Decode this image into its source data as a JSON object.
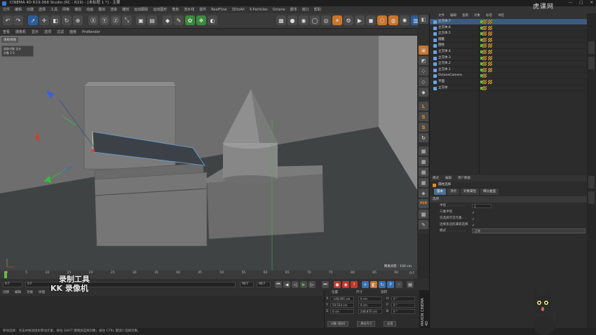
{
  "window": {
    "title": "CINEMA 4D R19.068 Studio (RC - R19) - [未标题 1 *] - 主要",
    "controls": [
      "—",
      "□",
      "✕"
    ]
  },
  "menubar": [
    "文件",
    "编辑",
    "创建",
    "选择",
    "工具",
    "网格",
    "捕捉",
    "动画",
    "模拟",
    "渲染",
    "雕刻",
    "运动跟踪",
    "运动图形",
    "角色",
    "流水线",
    "插件",
    "RealFlow",
    "3DtoAll",
    "X-Particles",
    "Octane",
    "脚本",
    "窗口",
    "帮助"
  ],
  "viewport": {
    "menu": [
      "查看",
      "摄像机",
      "显示",
      "选项",
      "过滤",
      "面板",
      "ProRender"
    ],
    "corner_label": "透视视图",
    "hud": {
      "line1": "选取对象  全计",
      "line2": "对象  1      0"
    },
    "grid_spacing": "网格间距 : 100 cm",
    "colors": {
      "bg_top": "#6f6f6f",
      "bg_floor": "#3f4344",
      "wall_right": "#8a8a8a"
    }
  },
  "objects": {
    "menu": [
      "文件",
      "编辑",
      "查看",
      "对象",
      "标签",
      "书签"
    ],
    "items": [
      {
        "name": "立方体.7",
        "selected": true
      },
      {
        "name": "立方体.6",
        "selected": false
      },
      {
        "name": "立方体.5",
        "selected": false
      },
      {
        "name": "圆锥",
        "selected": false
      },
      {
        "name": "圆柱",
        "selected": false
      },
      {
        "name": "立方体.4",
        "selected": false
      },
      {
        "name": "立方体.3",
        "selected": false
      },
      {
        "name": "立方体.2",
        "selected": false
      },
      {
        "name": "立方体.1",
        "selected": false
      },
      {
        "name": "OctaneCamera",
        "selected": false
      },
      {
        "name": "平面",
        "selected": false
      },
      {
        "name": "立方体",
        "selected": false
      }
    ]
  },
  "attributes": {
    "menu": [
      "模式",
      "编辑",
      "用户数据"
    ],
    "title": "圆柱选择",
    "tabs": [
      {
        "label": "基本",
        "active": true
      },
      {
        "label": "顶点",
        "active": false
      },
      {
        "label": "对象属性",
        "active": false
      },
      {
        "label": "细分曲面",
        "active": false
      }
    ],
    "section": "选项",
    "rows": [
      {
        "label": "半径 . . . . . . . . .",
        "value": "1"
      },
      {
        "label": "三维半径",
        "check": "✓"
      },
      {
        "label": "仅选择可见元素 . .",
        "check": "✓"
      },
      {
        "label": "边缘多边形兼容选择",
        "check": "✓"
      },
      {
        "label": "模式 . . . . . . . . . .",
        "dropdown": "正常"
      }
    ]
  },
  "timeline": {
    "ticks": [
      "0",
      "5",
      "10",
      "15",
      "20",
      "25",
      "30",
      "35",
      "40",
      "45",
      "50",
      "55",
      "60",
      "65",
      "70",
      "75",
      "80",
      "85",
      "90"
    ],
    "end_label": "0 F"
  },
  "transport": {
    "start": "0 F",
    "current": "0 F",
    "end": "90 F",
    "end2": "90 F"
  },
  "materials": {
    "menu": [
      "创建",
      "编辑",
      "功能",
      "纹理"
    ]
  },
  "coordinates": {
    "headers": [
      "位置",
      "尺寸",
      "旋转"
    ],
    "rows": [
      {
        "axis": "X",
        "pos": "-148.091 cm",
        "size": "0 cm",
        "rot_label": "H",
        "rot": "0 °"
      },
      {
        "axis": "Y",
        "pos": "50.524 cm",
        "size": "0 cm",
        "rot_label": "P",
        "rot": "0 °"
      },
      {
        "axis": "Z",
        "pos": "0 cm",
        "size": "248.870 cm",
        "rot_label": "B",
        "rot": "0 °"
      }
    ],
    "mode": "对象 (相对)",
    "size_mode": "绝对尺寸",
    "apply": "应用"
  },
  "status": "移动选择：点击并拖动鼠标移动元素。按住 SHIFT 键增加选择对象；按住 CTRL 键减少选择对象。",
  "watermark": {
    "line1": "录制工具",
    "line2": "KK 录像机",
    "corner": "虎课网"
  },
  "maxon_label": "MAXON CINEMA 4D"
}
